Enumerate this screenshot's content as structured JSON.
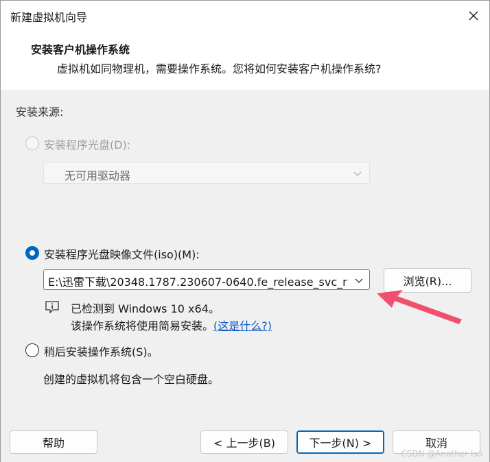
{
  "window": {
    "title": "新建虚拟机向导"
  },
  "header": {
    "title": "安装客户机操作系统",
    "subtitle": "虚拟机如同物理机，需要操作系统。您将如何安装客户机操作系统?"
  },
  "source": {
    "label": "安装来源:",
    "disc_option": "安装程序光盘(D):",
    "disc_drive_value": "无可用驱动器",
    "iso_option": "安装程序光盘映像文件(iso)(M):",
    "iso_path": "E:\\迅雷下载\\20348.1787.230607-0640.fe_release_svc_r",
    "browse_button": "浏览(R)...",
    "detected_text": "已检测到 Windows 10 x64。",
    "easy_install_text": "该操作系统将使用简易安装。",
    "what_is_this_link": "(这是什么?)",
    "later_option": "稍后安装操作系统(S)。",
    "later_description": "创建的虚拟机将包含一个空白硬盘。",
    "selected": "iso"
  },
  "footer": {
    "help_button": "帮助",
    "back_button": "< 上一步(B)",
    "next_button": "下一步(N) >",
    "cancel_button": "取消"
  },
  "watermark": "CSDN @Another Iso",
  "colors": {
    "accent": "#0067c0",
    "arrow": "#f0506e",
    "link": "#0a58ca"
  }
}
